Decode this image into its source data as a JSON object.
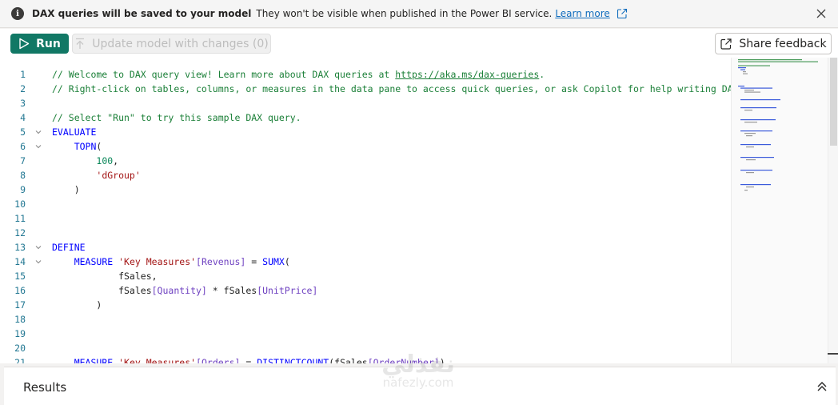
{
  "banner": {
    "title": "DAX queries will be saved to your model",
    "message": "They won't be visible when published in the Power BI service.",
    "link": "Learn more"
  },
  "toolbar": {
    "run_label": "Run",
    "update_label": "Update model with changes (0)",
    "share_label": "Share feedback"
  },
  "editor": {
    "lines": [
      {
        "n": "1",
        "fold": false,
        "tokens": [
          [
            "comment",
            "// Welcome to DAX query view! Learn more about DAX queries at "
          ],
          [
            "url",
            "https://aka.ms/dax-queries"
          ],
          [
            "comment",
            "."
          ]
        ]
      },
      {
        "n": "2",
        "fold": false,
        "tokens": [
          [
            "comment",
            "// Right-click on tables, columns, or measures in the data pane to access quick queries, or ask Copilot for help writing DAX."
          ]
        ]
      },
      {
        "n": "3",
        "fold": false,
        "tokens": []
      },
      {
        "n": "4",
        "fold": false,
        "tokens": [
          [
            "comment",
            "// Select \"Run\" to try this sample DAX query."
          ]
        ]
      },
      {
        "n": "5",
        "fold": true,
        "tokens": [
          [
            "kw",
            "EVALUATE"
          ]
        ]
      },
      {
        "n": "6",
        "fold": true,
        "tokens": [
          [
            "plain",
            "    "
          ],
          [
            "fn",
            "TOPN"
          ],
          [
            "plain",
            "("
          ]
        ]
      },
      {
        "n": "7",
        "fold": false,
        "tokens": [
          [
            "plain",
            "        "
          ],
          [
            "num",
            "100"
          ],
          [
            "plain",
            ","
          ]
        ]
      },
      {
        "n": "8",
        "fold": false,
        "tokens": [
          [
            "plain",
            "        "
          ],
          [
            "str",
            "'dGroup'"
          ]
        ]
      },
      {
        "n": "9",
        "fold": false,
        "tokens": [
          [
            "plain",
            "    )"
          ]
        ]
      },
      {
        "n": "10",
        "fold": false,
        "tokens": []
      },
      {
        "n": "11",
        "fold": false,
        "tokens": []
      },
      {
        "n": "12",
        "fold": false,
        "tokens": []
      },
      {
        "n": "13",
        "fold": true,
        "tokens": [
          [
            "kw",
            "DEFINE"
          ]
        ]
      },
      {
        "n": "14",
        "fold": true,
        "tokens": [
          [
            "plain",
            "    "
          ],
          [
            "kw",
            "MEASURE"
          ],
          [
            "plain",
            " "
          ],
          [
            "str",
            "'Key Measures'"
          ],
          [
            "col",
            "[Revenus]"
          ],
          [
            "plain",
            " = "
          ],
          [
            "fn",
            "SUMX"
          ],
          [
            "plain",
            "("
          ]
        ]
      },
      {
        "n": "15",
        "fold": false,
        "tokens": [
          [
            "plain",
            "            fSales,"
          ]
        ]
      },
      {
        "n": "16",
        "fold": false,
        "tokens": [
          [
            "plain",
            "            fSales"
          ],
          [
            "col",
            "[Quantity]"
          ],
          [
            "plain",
            " * fSales"
          ],
          [
            "col",
            "[UnitPrice]"
          ]
        ]
      },
      {
        "n": "17",
        "fold": false,
        "tokens": [
          [
            "plain",
            "        )"
          ]
        ]
      },
      {
        "n": "18",
        "fold": false,
        "tokens": []
      },
      {
        "n": "19",
        "fold": false,
        "tokens": []
      },
      {
        "n": "20",
        "fold": false,
        "tokens": []
      },
      {
        "n": "21",
        "fold": false,
        "tokens": [
          [
            "plain",
            "    "
          ],
          [
            "kw",
            "MEASURE"
          ],
          [
            "plain",
            " "
          ],
          [
            "str",
            "'Key Measures'"
          ],
          [
            "col",
            "[Orders]"
          ],
          [
            "plain",
            " = "
          ],
          [
            "fn",
            "DISTINCTCOUNT"
          ],
          [
            "plain",
            "(fSales"
          ],
          [
            "col",
            "[OrderNumber]"
          ],
          [
            "plain",
            ")"
          ]
        ]
      }
    ]
  },
  "results": {
    "title": "Results"
  },
  "watermark": {
    "top": "نفذلي",
    "bottom": "nafezly.com"
  },
  "colors": {
    "run_bg": "#117865",
    "comment": "#1a7f37",
    "keyword": "#0000ff",
    "string": "#a31515",
    "number": "#098658",
    "column": "#6f42c1",
    "line_number": "#237893",
    "link": "#0f6cbd"
  },
  "icons": {
    "banner": "info-icon",
    "link": "external-link-icon",
    "close": "close-icon",
    "run": "play-icon",
    "update": "upload-arrow-icon",
    "share": "open-external-icon",
    "fold": "chevron-down-icon",
    "results": "double-chevron-up-icon"
  }
}
